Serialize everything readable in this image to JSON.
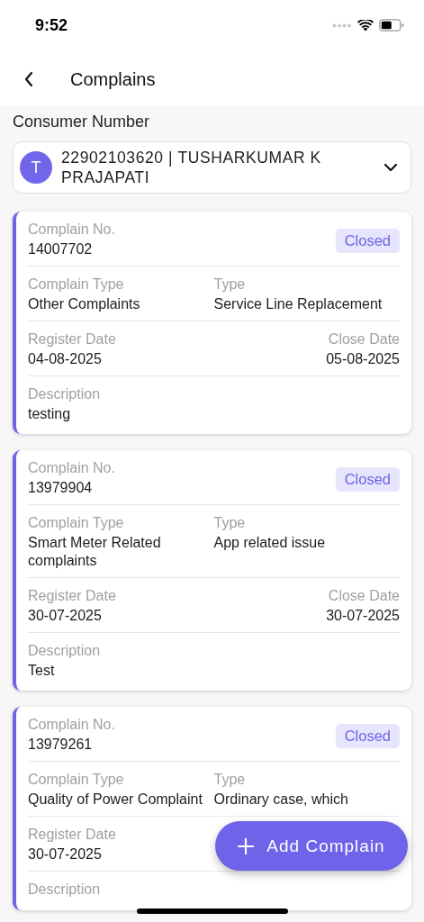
{
  "status_bar": {
    "time": "9:52"
  },
  "header": {
    "title": "Complains"
  },
  "consumer": {
    "label": "Consumer Number",
    "avatar": "T",
    "value": "22902103620 | TUSHARKUMAR K PRAJAPATI"
  },
  "complaints": [
    {
      "number_label": "Complain No.",
      "number": "14007702",
      "status": "Closed",
      "complaint_type_label": "Complain Type",
      "complaint_type": "Other Complaints",
      "type_label": "Type",
      "type": "Service Line Replacement",
      "register_label": "Register Date",
      "register_date": "04-08-2025",
      "close_label": "Close Date",
      "close_date": "05-08-2025",
      "description_label": "Description",
      "description": "testing"
    },
    {
      "number_label": "Complain No.",
      "number": "13979904",
      "status": "Closed",
      "complaint_type_label": "Complain Type",
      "complaint_type": "Smart Meter Related complaints",
      "type_label": "Type",
      "type": "App related issue",
      "register_label": "Register Date",
      "register_date": "30-07-2025",
      "close_label": "Close Date",
      "close_date": "30-07-2025",
      "description_label": "Description",
      "description": "Test"
    },
    {
      "number_label": "Complain No.",
      "number": "13979261",
      "status": "Closed",
      "complaint_type_label": "Complain Type",
      "complaint_type": "Quality of Power Complaint",
      "type_label": "Type",
      "type": "Ordinary case, which",
      "register_label": "Register Date",
      "register_date": "30-07-2025",
      "description_label": "Description"
    }
  ],
  "fab": {
    "label": "Add Complain"
  }
}
